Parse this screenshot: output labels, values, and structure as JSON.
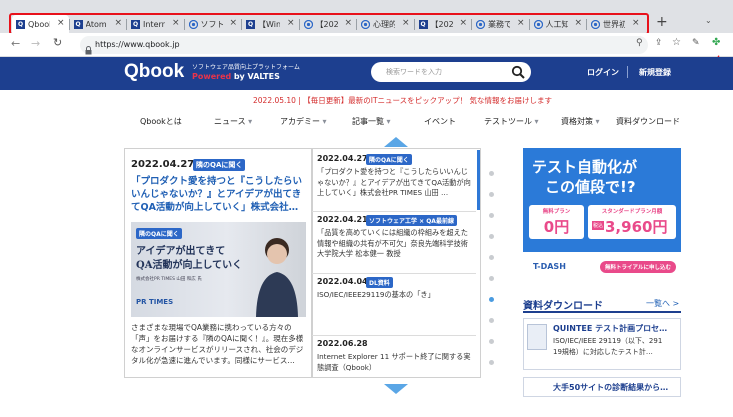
{
  "browser": {
    "tabs": [
      {
        "label": "Qbook",
        "icon": "qbook-favicon"
      },
      {
        "label": "Atom",
        "icon": "qbook-favicon"
      },
      {
        "label": "Intern",
        "icon": "qbook-favicon"
      },
      {
        "label": "ソフトウ",
        "icon": "target-favicon"
      },
      {
        "label": "【Wind",
        "icon": "qbook-favicon"
      },
      {
        "label": "【2022",
        "icon": "target-favicon"
      },
      {
        "label": "心理的",
        "icon": "target-favicon"
      },
      {
        "label": "【2022",
        "icon": "qbook-favicon"
      },
      {
        "label": "業務で",
        "icon": "target-favicon"
      },
      {
        "label": "人工知",
        "icon": "target-favicon"
      },
      {
        "label": "世界初",
        "icon": "target-favicon"
      }
    ],
    "new_tab": "+",
    "url": "https://www.qbook.jp",
    "highlight_color": "#e8111b"
  },
  "header": {
    "logo": "Qbook",
    "tagline_line1": "ソフトウェア品質向上プラットフォーム",
    "tagline_powered": "Powered",
    "tagline_by": "by VALTES",
    "search_placeholder": "検索ワードを入力",
    "login": "ログイン",
    "register": "新規登録",
    "brand_color": "#1d3f8f"
  },
  "notice": "2022.05.10 | 【毎日更新】最新のITニュースをピックアップ！ 気な情報をお届けします",
  "nav": [
    {
      "label": "Qbookとは",
      "has_caret": false
    },
    {
      "label": "ニュース",
      "has_caret": true
    },
    {
      "label": "アカデミー",
      "has_caret": true
    },
    {
      "label": "記事一覧",
      "has_caret": true
    },
    {
      "label": "イベント",
      "has_caret": false
    },
    {
      "label": "テストツール",
      "has_caret": true
    },
    {
      "label": "資格対策",
      "has_caret": true
    },
    {
      "label": "資料ダウンロード",
      "has_caret": false
    }
  ],
  "feature": {
    "date": "2022.04.27",
    "badge": "隣のQAに聞く",
    "title": "「プロダクト愛を持つと『こうしたらいいんじゃないか？』とアイデアが出てきてQA活動が向上していく」株式会社…",
    "image_badge": "隣のQAに聞く",
    "image_line1": "アイデアが出てきて",
    "image_line2": "QA活動が向上していく",
    "image_caption": "株式会社PR TIMES 山田 和広 氏",
    "image_logo": "PR TIMES",
    "body": "さまざまな現場でQA業務に携わっている方々の「声」をお届けする『隣のQAに聞く！』。現在多様なオンラインサービスがリリースされ、社会のデジタル化が急速に進んでいます。同様にサービス…"
  },
  "list": [
    {
      "date": "2022.04.27",
      "badge": "隣のQAに聞く",
      "text": "「プロダクト愛を持つと『こうしたらいいんじゃないか？』とアイデアが出てきてQA活動が向上していく」株式会社PR TIMES 山田 …"
    },
    {
      "date": "2022.04.21",
      "badge": "ソフトウェア工学 × QA最前線",
      "text": "「品質を高めていくには組織の枠組みを超えた情報や組織の共有が不可欠」奈良先端科学技術大学院大学 松本健一 教授"
    },
    {
      "date": "2022.04.04",
      "badge": "DL資料",
      "text": "ISO/IEC/IEEE29119の基本の「き」"
    },
    {
      "date": "2022.06.28",
      "badge": "",
      "text": "Internet Explorer 11 サポート終了に関する実態調査（Qbook）"
    }
  ],
  "ad": {
    "headline1": "テスト自動化が",
    "headline2": "この値段で!?",
    "plan1_label": "無料プラン",
    "plan1_price": "0円",
    "plan2_label": "スタンダードプラン月額",
    "plan2_prefix": "税込",
    "plan2_price": "3,960円",
    "brand": "T-DASH",
    "cta": "無料トライアルに申し込む"
  },
  "downloads": {
    "heading": "資料ダウンロード",
    "more": "一覧へ >",
    "items": [
      {
        "title": "QUINTEE テスト計画プロセ…",
        "sub1": "ISO/IEC/IEEE 29119（以下、291",
        "sub2": "19規格）に対応したテスト計…"
      },
      {
        "title": "大手50サイトの診断結果から…"
      }
    ]
  }
}
